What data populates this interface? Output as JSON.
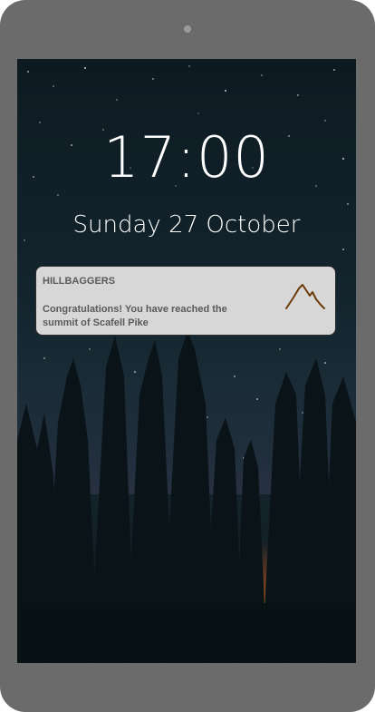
{
  "lockscreen": {
    "time": "17:00",
    "date": "Sunday 27 October"
  },
  "notification": {
    "app_name": "HILLBAGGERS",
    "message": "Congratulations! You have reached the summit of Scafell Pike",
    "icon": "mountain-icon"
  },
  "colors": {
    "device_frame": "#6b6b6b",
    "notification_bg": "#d7d7d7",
    "notification_text": "#5a5a5a",
    "icon_stroke": "#6b3a0a"
  }
}
